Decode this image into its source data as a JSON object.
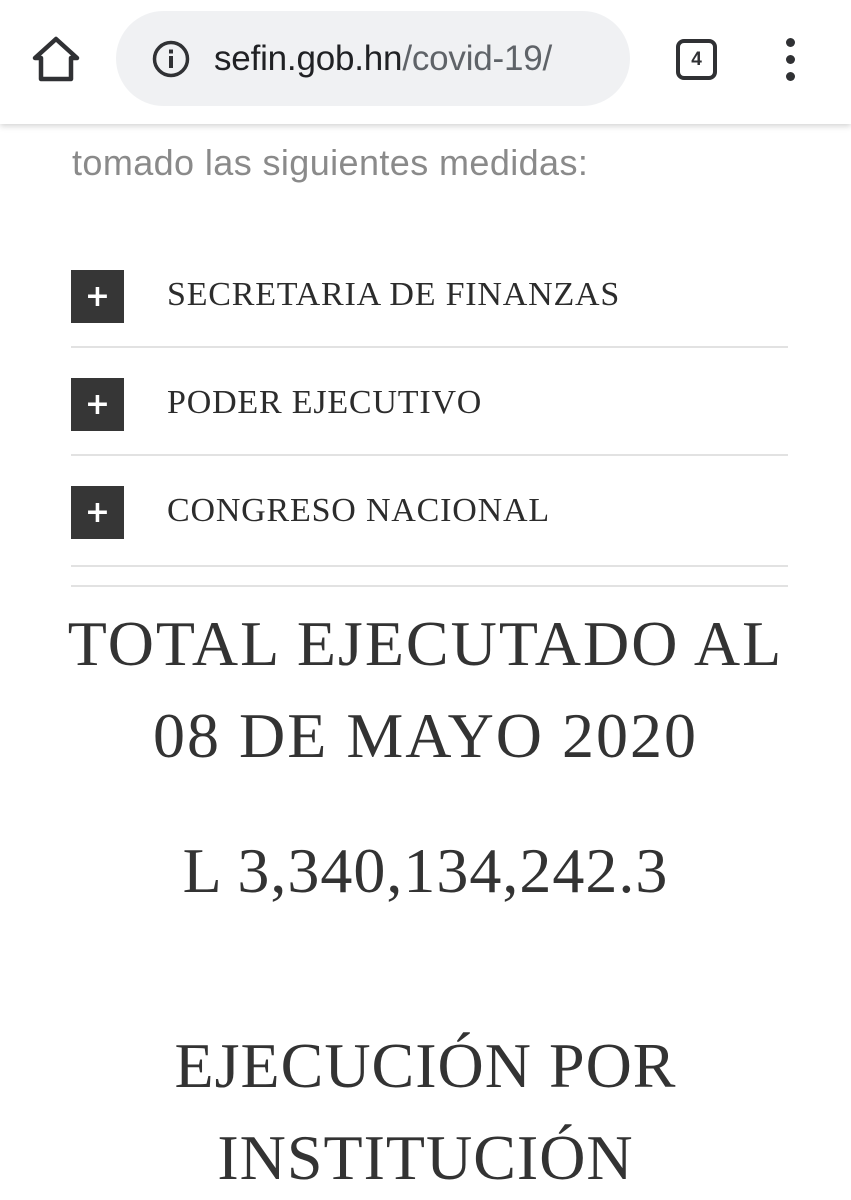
{
  "browser": {
    "url_domain": "sefin.gob.hn",
    "url_path": "/covid-19/",
    "tab_count": "4",
    "icons": {
      "home": "home-icon",
      "info": "info-icon",
      "tabs": "tab-switcher-icon",
      "menu": "more-vert-icon"
    }
  },
  "page": {
    "intro_text": "tomado las siguientes medidas:",
    "accordion": [
      {
        "toggle": "+",
        "label": "SECRETARIA DE FINANZAS"
      },
      {
        "toggle": "+",
        "label": "PODER EJECUTIVO"
      },
      {
        "toggle": "+",
        "label": "CONGRESO NACIONAL"
      }
    ],
    "total_title_line1": "TOTAL EJECUTADO AL",
    "total_title_line2": "08 DE MAYO 2020",
    "total_amount": "L 3,340,134,242.3",
    "section_title_line1": "EJECUCIÓN POR",
    "section_title_line2": "INSTITUCIÓN"
  },
  "colors": {
    "toggle_bg": "#363636",
    "text_dark": "#333333",
    "intro_gray": "#8a8a8a",
    "urlbar_bg": "#f0f1f3",
    "divider": "#e2e2e2"
  }
}
